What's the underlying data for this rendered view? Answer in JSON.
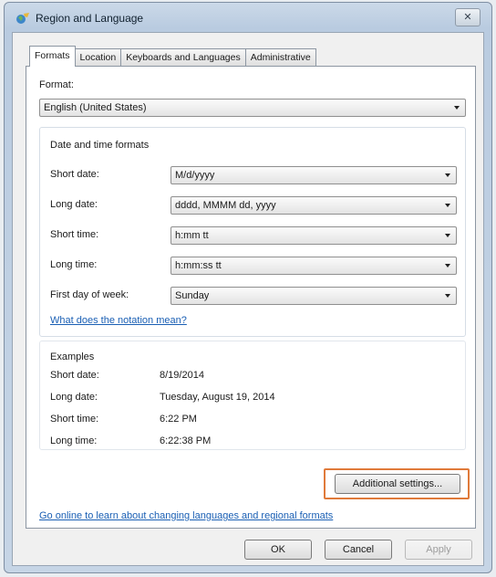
{
  "window": {
    "title": "Region and Language",
    "close_symbol": "✕"
  },
  "tabs": [
    {
      "label": "Formats",
      "active": true
    },
    {
      "label": "Location"
    },
    {
      "label": "Keyboards and Languages"
    },
    {
      "label": "Administrative"
    }
  ],
  "format": {
    "label": "Format:",
    "value": "English (United States)"
  },
  "date_time": {
    "group_label": "Date and time formats",
    "rows": [
      {
        "label": "Short date:",
        "value": "M/d/yyyy"
      },
      {
        "label": "Long date:",
        "value": "dddd, MMMM dd, yyyy"
      },
      {
        "label": "Short time:",
        "value": "h:mm tt"
      },
      {
        "label": "Long time:",
        "value": "h:mm:ss tt"
      },
      {
        "label": "First day of week:",
        "value": "Sunday"
      }
    ],
    "notation_link": "What does the notation mean?"
  },
  "examples": {
    "label": "Examples",
    "rows": [
      {
        "label": "Short date:",
        "value": "8/19/2014"
      },
      {
        "label": "Long date:",
        "value": "Tuesday, August 19, 2014"
      },
      {
        "label": "Short time:",
        "value": "6:22 PM"
      },
      {
        "label": "Long time:",
        "value": "6:22:38 PM"
      }
    ]
  },
  "additional_settings_label": "Additional settings...",
  "online_link": "Go online to learn about changing languages and regional formats",
  "footer": {
    "ok_label": "OK",
    "cancel_label": "Cancel",
    "apply_label": "Apply"
  },
  "colors": {
    "highlight": "#e07a3a",
    "link": "#1a5fb4"
  }
}
